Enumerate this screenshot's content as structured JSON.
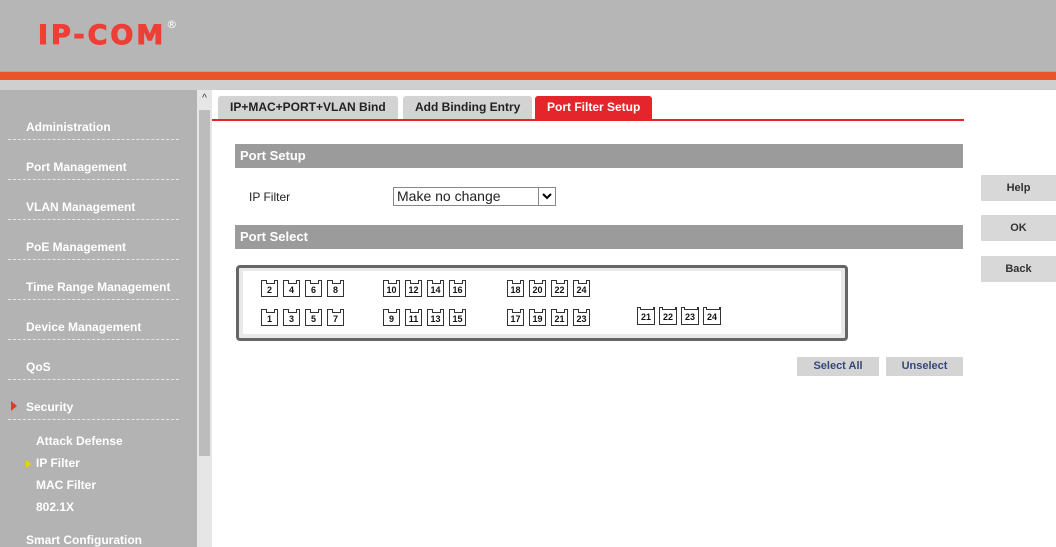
{
  "header": {
    "logo": "IP-COM",
    "logo_mark": "®"
  },
  "sidebar": {
    "items": [
      {
        "label": "Administration"
      },
      {
        "label": "Port Management"
      },
      {
        "label": "VLAN Management"
      },
      {
        "label": "PoE Management"
      },
      {
        "label": "Time Range Management"
      },
      {
        "label": "Device Management"
      },
      {
        "label": "QoS"
      },
      {
        "label": "Security"
      },
      {
        "label": "Smart Configuration"
      }
    ],
    "security_sub": [
      {
        "label": "Attack Defense"
      },
      {
        "label": "IP Filter"
      },
      {
        "label": "MAC Filter"
      },
      {
        "label": "802.1X"
      }
    ]
  },
  "tabs": [
    {
      "label": "IP+MAC+PORT+VLAN Bind"
    },
    {
      "label": "Add Binding Entry"
    },
    {
      "label": "Port Filter Setup"
    }
  ],
  "port_setup": {
    "title": "Port Setup",
    "ip_filter_label": "IP Filter",
    "ip_filter_value": "Make no change"
  },
  "port_select": {
    "title": "Port Select",
    "top_row": [
      "2",
      "4",
      "6",
      "8",
      "10",
      "12",
      "14",
      "16",
      "18",
      "20",
      "22",
      "24"
    ],
    "bottom_row": [
      "1",
      "3",
      "5",
      "7",
      "9",
      "11",
      "13",
      "15",
      "17",
      "19",
      "21",
      "23"
    ],
    "sfp_ports": [
      "21",
      "22",
      "23",
      "24"
    ]
  },
  "buttons": {
    "select_all": "Select All",
    "unselect": "Unselect",
    "help": "Help",
    "ok": "OK",
    "back": "Back"
  }
}
